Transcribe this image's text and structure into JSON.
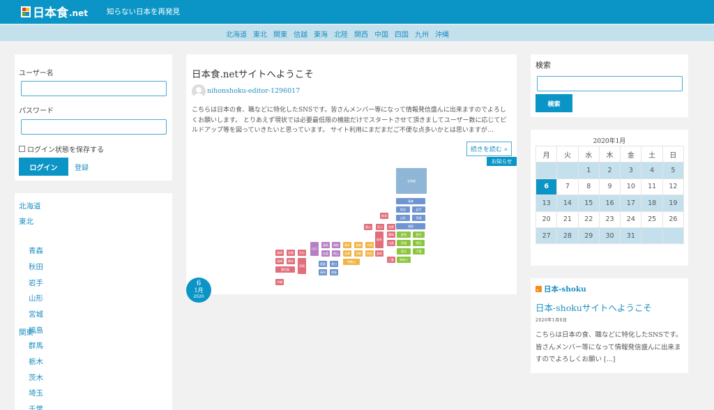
{
  "header": {
    "logo_text": "日本食",
    "logo_suffix": ".net",
    "tagline": "知らない日本を再発見"
  },
  "nav": [
    "北海道",
    "東北",
    "関東",
    "信越",
    "東海",
    "北陸",
    "関西",
    "中国",
    "四国",
    "九州",
    "沖縄"
  ],
  "login": {
    "username_label": "ユーザー名",
    "password_label": "パスワード",
    "remember_label": "ログイン状態を保存する",
    "login_button": "ログイン",
    "register_link": "登録"
  },
  "regions": {
    "r1": "北海道",
    "r2": "東北",
    "r2_items": [
      "青森",
      "秋田",
      "岩手",
      "山形",
      "宮城",
      "福島"
    ],
    "r3": "関東",
    "r3_items": [
      "群馬",
      "栃木",
      "茨木",
      "埼玉",
      "千葉"
    ]
  },
  "post": {
    "title": "日本食.netサイトへようこそ",
    "author": "nihonshoku-editor-1296017",
    "excerpt": "こちらは日本の食、職などに特化したSNSです。皆さんメンバー等になって情報発信盛んに出来ますのでよろしくお願いします。 とりあえず現状では必要最低限の機能だけでスタートさせて頂きましてユーザー数に応じてビルドアップ等を図っていきたいと思っています。 サイト利用にまだまだご不便な点多いかとは思いますが…",
    "more": "続きを読む »",
    "category": "お知らせ",
    "date_day": "6",
    "date_month": "1月",
    "date_year": "2020"
  },
  "map_tiles": [
    {
      "l": "北海道",
      "c": "#8fb6d6"
    },
    {
      "l": "青森",
      "c": "#6f95d1"
    },
    {
      "l": "秋田",
      "c": "#6f95d1"
    },
    {
      "l": "岩手",
      "c": "#6f95d1"
    },
    {
      "l": "山形",
      "c": "#6f95d1"
    },
    {
      "l": "宮城",
      "c": "#6f95d1"
    },
    {
      "l": "福島",
      "c": "#6f95d1"
    },
    {
      "l": "新潟",
      "c": "#e06f7b"
    },
    {
      "l": "富山",
      "c": "#e06f7b"
    },
    {
      "l": "石川",
      "c": "#e06f7b"
    },
    {
      "l": "長野",
      "c": "#e06f7b"
    },
    {
      "l": "群馬",
      "c": "#8cc63f"
    },
    {
      "l": "栃木",
      "c": "#8cc63f"
    },
    {
      "l": "茨城",
      "c": "#8cc63f"
    },
    {
      "l": "埼玉",
      "c": "#8cc63f"
    },
    {
      "l": "千葉",
      "c": "#8cc63f"
    },
    {
      "l": "東京",
      "c": "#8cc63f"
    },
    {
      "l": "神奈川",
      "c": "#8cc63f"
    },
    {
      "l": "岐阜",
      "c": "#e06f7b"
    },
    {
      "l": "静岡",
      "c": "#e06f7b"
    },
    {
      "l": "山梨",
      "c": "#e06f7b"
    },
    {
      "l": "福井",
      "c": "#f0b447"
    },
    {
      "l": "滋賀",
      "c": "#f0b447"
    },
    {
      "l": "京都",
      "c": "#f0b447"
    },
    {
      "l": "兵庫",
      "c": "#f0b447"
    },
    {
      "l": "大阪",
      "c": "#f0b447"
    },
    {
      "l": "奈良",
      "c": "#f0b447"
    },
    {
      "l": "和歌山",
      "c": "#f0b447"
    },
    {
      "l": "愛知",
      "c": "#e06f7b"
    },
    {
      "l": "三重",
      "c": "#e06f7b"
    },
    {
      "l": "島根",
      "c": "#b57fc4"
    },
    {
      "l": "鳥取",
      "c": "#b57fc4"
    },
    {
      "l": "山口",
      "c": "#b57fc4"
    },
    {
      "l": "広島",
      "c": "#b57fc4"
    },
    {
      "l": "岡山",
      "c": "#b57fc4"
    },
    {
      "l": "愛媛",
      "c": "#6f95d1"
    },
    {
      "l": "香川",
      "c": "#6f95d1"
    },
    {
      "l": "高知",
      "c": "#6f95d1"
    },
    {
      "l": "徳島",
      "c": "#6f95d1"
    },
    {
      "l": "福岡",
      "c": "#e06f7b"
    },
    {
      "l": "佐賀",
      "c": "#e06f7b"
    },
    {
      "l": "長崎",
      "c": "#e06f7b"
    },
    {
      "l": "大分",
      "c": "#e06f7b"
    },
    {
      "l": "熊本",
      "c": "#e06f7b"
    },
    {
      "l": "宮崎",
      "c": "#e06f7b"
    },
    {
      "l": "鹿児島",
      "c": "#e06f7b"
    },
    {
      "l": "沖縄",
      "c": "#e06f7b"
    }
  ],
  "search": {
    "title": "検索",
    "button": "検索"
  },
  "calendar": {
    "caption": "2020年1月",
    "weekdays": [
      "月",
      "火",
      "水",
      "木",
      "金",
      "土",
      "日"
    ],
    "weeks": [
      [
        "",
        "",
        "1",
        "2",
        "3",
        "4",
        "5"
      ],
      [
        "6",
        "7",
        "8",
        "9",
        "10",
        "11",
        "12"
      ],
      [
        "13",
        "14",
        "15",
        "16",
        "17",
        "18",
        "19"
      ],
      [
        "20",
        "21",
        "22",
        "23",
        "24",
        "25",
        "26"
      ],
      [
        "27",
        "28",
        "29",
        "30",
        "31",
        "",
        ""
      ]
    ],
    "today": "6"
  },
  "rss": {
    "feed_name": "日本-shoku",
    "title": "日本-shokuサイトへようこそ",
    "date": "2020年1月6日",
    "excerpt": "こちらは日本の食、職などに特化したSNSです。皆さんメンバー等になって情報発信盛んに出来ますのでよろしくお願い [...]"
  },
  "colors": {
    "primary": "#0b95c6",
    "nav_bg": "#c4e0ec",
    "link": "#1d8fc2"
  }
}
